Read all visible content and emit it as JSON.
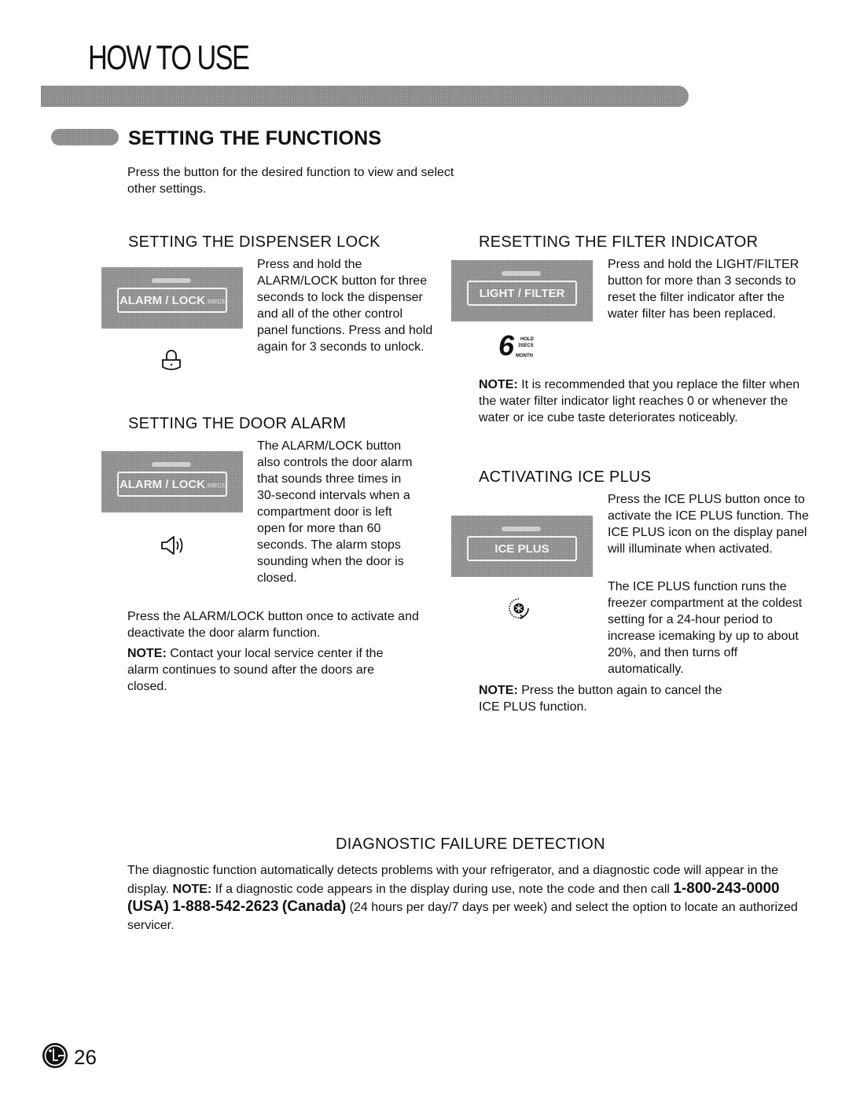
{
  "page": {
    "title": "HOW TO USE",
    "section_heading": "SETTING THE FUNCTIONS",
    "intro": "Press the button for the desired function to view and select other settings.",
    "page_number": "26",
    "logo": "lg-logo-icon"
  },
  "dispenser_lock": {
    "heading": "SETTING THE DISPENSER LOCK",
    "button_label": "ALARM / LOCK",
    "button_sub": "3SECS",
    "icon": "lock-icon",
    "text": "Press and hold the ALARM/LOCK button for three seconds to lock the dispenser and all of the other control panel functions. Press and hold again for 3 seconds to unlock."
  },
  "door_alarm": {
    "heading": "SETTING THE DOOR ALARM",
    "button_label": "ALARM / LOCK",
    "button_sub": "3SECS",
    "icon": "speaker-icon",
    "text": "The ALARM/LOCK button also controls the door alarm that sounds three times in 30-second intervals when a compartment door is left open for more than 60 seconds. The alarm stops sounding when the door is closed.",
    "text2": "Press the ALARM/LOCK button once to activate and deactivate the door alarm function.",
    "note_label": "NOTE:",
    "note": "Contact your local service center if the alarm continues to sound after the doors are closed."
  },
  "filter_indicator": {
    "heading": "RESETTING THE FILTER INDICATOR",
    "button_label": "LIGHT / FILTER",
    "display_digit": "6",
    "display_hold": "HOLD",
    "display_secs": "3SECS",
    "display_month": "MONTH",
    "text": "Press and hold the LIGHT/FILTER button for more than 3 seconds to reset the filter indicator after the water filter has been replaced.",
    "note_label": "NOTE:",
    "note": "It is recommended that you replace the filter when the water filter indicator light reaches 0 or whenever the water or ice cube taste deteriorates noticeably."
  },
  "ice_plus": {
    "heading": "ACTIVATING ICE PLUS",
    "button_label": "ICE PLUS",
    "icon": "ice-plus-snowflake-icon",
    "text": "Press the ICE PLUS button once to activate the ICE PLUS function. The ICE PLUS icon on the display panel will illuminate when activated.",
    "text2": "The ICE PLUS function runs the freezer compartment at the coldest setting for a 24-hour period to increase icemaking by up to about 20%, and then turns off automatically.",
    "note_label": "NOTE:",
    "note": "Press the button again to cancel the ICE PLUS function."
  },
  "diagnostic": {
    "heading": "DIAGNOSTIC FAILURE DETECTION",
    "text_a": "The diagnostic function automatically detects problems with your refrigerator, and a diagnostic code will appear in the display.",
    "note_label": "NOTE:",
    "text_b": "If a diagnostic code appears in the display during use, note the code and then call",
    "phone_usa": "1-800-243-0000",
    "usa_label": "(USA)",
    "phone_canada": "1-888-542-2623",
    "canada_label": "(Canada)",
    "text_c": "(24 hours per day/7 days per week) and select the option to locate an authorized servicer."
  }
}
